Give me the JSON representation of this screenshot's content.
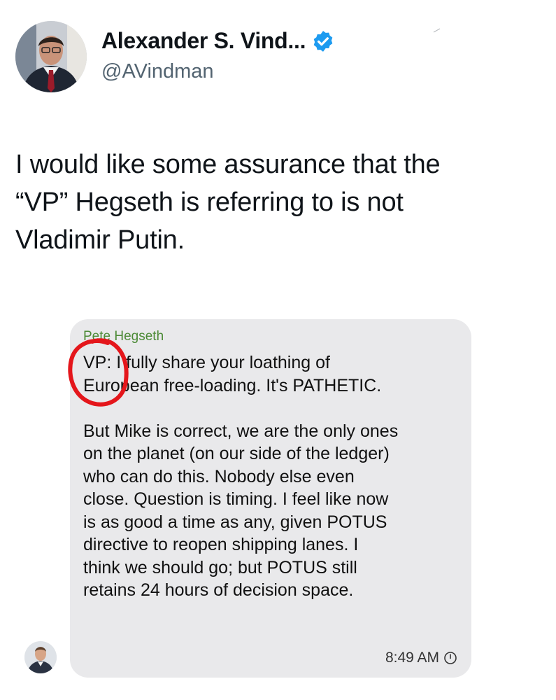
{
  "author": {
    "name": "Alexander S. Vind...",
    "handle": "@AVindman",
    "avatar_icon": "profile-photo",
    "verified_icon": "verified-badge-icon",
    "verified_color": "#1d9bf0"
  },
  "tweet": {
    "text": "I would like some assurance that the\n“VP” Hegseth is referring to is not\nVladimir Putin."
  },
  "screenshot": {
    "sender": "Pete Hegseth",
    "message": "VP: I fully share your loathing of\nEuropean free-loading. It's PATHETIC.\n\nBut Mike is correct, we are the only ones\non the planet (on our side of the ledger)\nwho can do this. Nobody else even\nclose. Question is timing. I feel like now\nis as good a time as any, given POTUS\ndirective to reopen shipping lanes. I\nthink we should go; but POTUS still\nretains 24 hours of decision space.",
    "time": "8:49 AM",
    "time_icon": "clock-icon",
    "sender_color": "#4c8a36",
    "bubble_color": "#e9e9eb",
    "annotation_color": "#e4161b"
  }
}
